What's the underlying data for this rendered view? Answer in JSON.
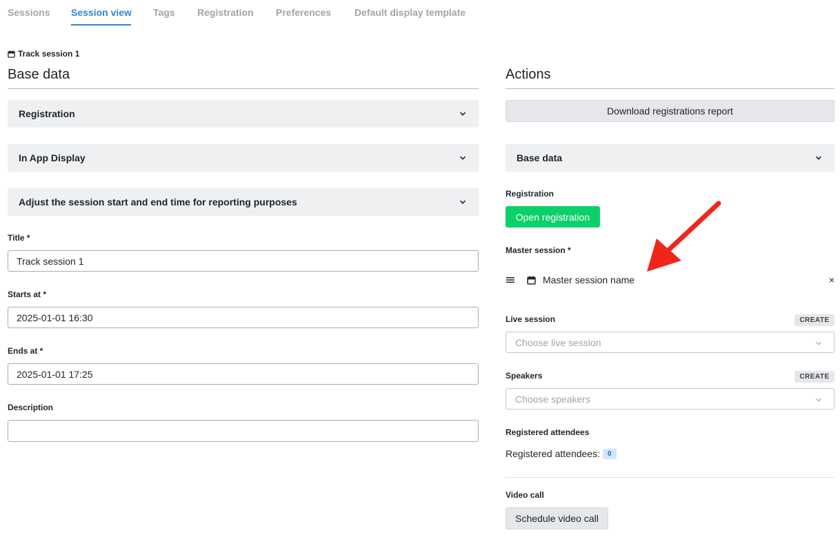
{
  "tabs": [
    {
      "label": "Sessions"
    },
    {
      "label": "Session view"
    },
    {
      "label": "Tags"
    },
    {
      "label": "Registration"
    },
    {
      "label": "Preferences"
    },
    {
      "label": "Default display template"
    }
  ],
  "context_label": "Track session 1",
  "left": {
    "title": "Base data",
    "accordions": [
      {
        "label": "Registration"
      },
      {
        "label": "In App Display"
      },
      {
        "label": "Adjust the session start and end time for reporting purposes"
      }
    ],
    "fields": {
      "title": {
        "label": "Title *",
        "value": "Track session 1"
      },
      "starts_at": {
        "label": "Starts at *",
        "value": "2025-01-01 16:30"
      },
      "ends_at": {
        "label": "Ends at *",
        "value": "2025-01-01 17:25"
      },
      "description": {
        "label": "Description",
        "value": ""
      }
    }
  },
  "right": {
    "title": "Actions",
    "download_button": "Download registrations report",
    "base_data_accordion": "Base data",
    "registration": {
      "label": "Registration",
      "button": "Open registration"
    },
    "master_session": {
      "label": "Master session *",
      "name": "Master session name",
      "remove": "×"
    },
    "live_session": {
      "label": "Live session",
      "create": "CREATE",
      "placeholder": "Choose live session"
    },
    "speakers": {
      "label": "Speakers",
      "create": "CREATE",
      "placeholder": "Choose speakers"
    },
    "registered_attendees": {
      "label": "Registered attendees",
      "text": "Registered attendees:",
      "count": "0"
    },
    "video_call": {
      "label": "Video call",
      "button": "Schedule video call"
    }
  },
  "colors": {
    "accent": "#2f86d4",
    "success": "#0cd16a",
    "annotation_arrow": "#f0261b"
  }
}
